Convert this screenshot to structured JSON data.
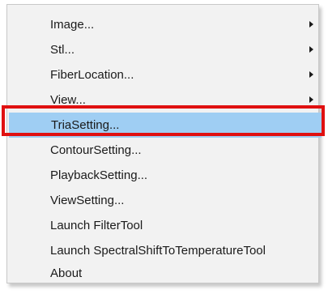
{
  "menu": {
    "items": [
      {
        "label": "Image...",
        "submenu": true
      },
      {
        "label": "Stl...",
        "submenu": true
      },
      {
        "label": "FiberLocation...",
        "submenu": true
      },
      {
        "label": "View...",
        "submenu": true
      },
      {
        "label": "TriaSetting...",
        "submenu": false,
        "highlighted": true
      },
      {
        "label": "ContourSetting...",
        "submenu": false
      },
      {
        "label": "PlaybackSetting...",
        "submenu": false
      },
      {
        "label": "ViewSetting...",
        "submenu": false
      },
      {
        "label": "Launch FilterTool",
        "submenu": false
      },
      {
        "label": "Launch SpectralShiftToTemperatureTool",
        "submenu": false
      },
      {
        "label": "About",
        "submenu": false
      }
    ]
  },
  "colors": {
    "menu_bg": "#f2f2f2",
    "highlight_bg": "#9fcef3",
    "annotation_border": "#e01010"
  },
  "icons": {
    "submenu_arrow": "chevron-right-icon"
  }
}
